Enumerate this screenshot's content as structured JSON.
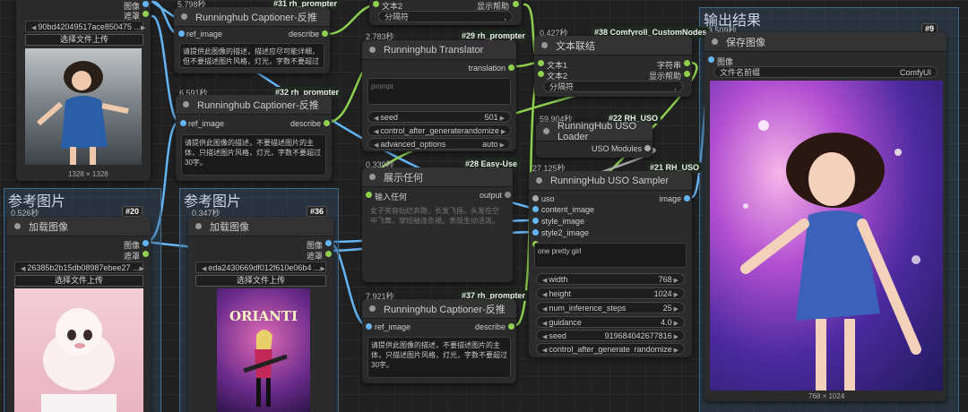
{
  "groups": {
    "ref1": "参考图片",
    "ref2": "参考图片",
    "output": "输出结果"
  },
  "node_top_left": {
    "widgets": [
      "图像",
      "遮罩"
    ],
    "file": "90bd42049517ace850475 ...",
    "upload": "选择文件上传",
    "size": "1328 × 1328"
  },
  "n31": {
    "time": "5.798秒",
    "id": "#31 rh_prompter",
    "title": "Runninghub Captioner-反推",
    "in": "ref_image",
    "out": "describe",
    "prompt": "请提供此图像的描述，描述应尽可能详细，但不要描述图片风格，灯光，字数不要超过30字。"
  },
  "n32": {
    "time": "6.591秒",
    "id": "#32 rh_prompter",
    "title": "Runninghub Captioner-反推",
    "in": "ref_image",
    "out": "describe",
    "prompt": "请提供此图像的描述，不要描述图片的主体，只描述图片风格，灯光，字数不要超过30字。"
  },
  "n20": {
    "time": "0.526秒",
    "id": "#20",
    "title": "加载图像",
    "out1": "图像",
    "out2": "遮罩",
    "file": "26385b2b15db08987ebee27 ...",
    "upload": "选择文件上传"
  },
  "n36": {
    "time": "0.347秒",
    "id": "#36",
    "title": "加载图像",
    "out1": "图像",
    "out2": "遮罩",
    "file": "eda2430669df012f610e06b4 ...",
    "upload": "选择文件上传",
    "poster": "ORIANTI"
  },
  "concat_top": {
    "in": "文本2",
    "out": "显示帮助",
    "sep": "分隔符"
  },
  "n29": {
    "time": "2.783秒",
    "id": "#29 rh_prompter",
    "title": "Runninghub Translator",
    "out": "translation",
    "placeholder": "prompt",
    "seed_label": "seed",
    "seed": "501",
    "cag_label": "control_after_generate",
    "cag": "randomize",
    "adv_label": "advanced_options",
    "adv": "auto"
  },
  "n28": {
    "time": "0.339秒",
    "id": "#28 Easy-Use",
    "title": "展示任何",
    "in": "输入任何",
    "out": "output",
    "text": "女子笑容灿烂奔跑，长发飞扬，头发在空中飞舞，穿短袖连衣裙，表现生动活泼。"
  },
  "n37": {
    "time": "7.921秒",
    "id": "#37 rh_prompter",
    "title": "Runninghub Captioner-反推",
    "in": "ref_image",
    "out": "describe",
    "prompt": "请提供此图像的描述，不要描述图片的主体，只描述图片风格，灯光，字数不要超过30字。"
  },
  "n38": {
    "time": "0.427秒",
    "id": "#38 Comfyroll_CustomNodes",
    "title": "文本联结",
    "in1": "文本1",
    "in2": "文本2",
    "out1": "字符串",
    "out2": "显示帮助",
    "sep": "分隔符",
    "sep_val": ","
  },
  "n22": {
    "time": "59.904秒",
    "id": "#22 RH_USO",
    "title": "RunningHub USO Loader",
    "out": "USO Modules"
  },
  "n21": {
    "time": "27.125秒",
    "id": "#21 RH_USO",
    "title": "RunningHub USO Sampler",
    "inputs": [
      "uso",
      "content_image",
      "style_image",
      "style2_image"
    ],
    "out": "image",
    "prompt": "one pretty girl",
    "params": [
      {
        "k": "width",
        "v": "768"
      },
      {
        "k": "height",
        "v": "1024"
      },
      {
        "k": "num_inference_steps",
        "v": "25"
      },
      {
        "k": "guidance",
        "v": "4.0"
      },
      {
        "k": "seed",
        "v": "919684042677816"
      },
      {
        "k": "control_after_generate",
        "v": "randomize"
      }
    ]
  },
  "n9": {
    "time": "3.509秒",
    "id": "#9",
    "title": "保存图像",
    "in": "图像",
    "prefix_label": "文件名前缀",
    "prefix": "ComfyUI",
    "size": "768 × 1024"
  },
  "colors": {
    "bg": "#202020",
    "group": "#3b5a76",
    "wire_green": "#8fd14f",
    "wire_blue": "#64b5f6",
    "socket_blue": "#64b5f6",
    "socket_green": "#8fd14f"
  }
}
